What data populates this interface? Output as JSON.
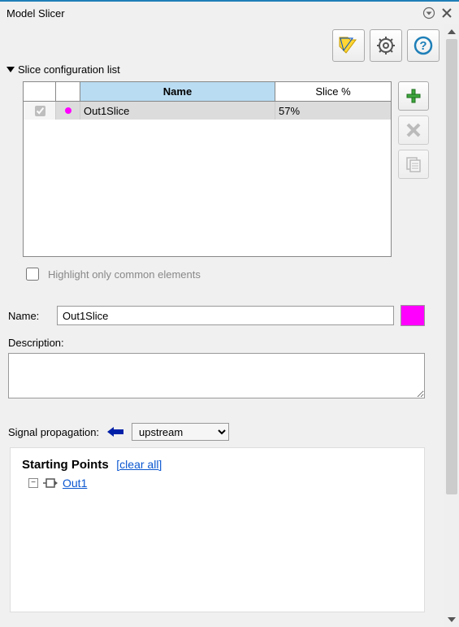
{
  "window": {
    "title": "Model Slicer"
  },
  "section_list": {
    "label": "Slice configuration list"
  },
  "table": {
    "columns": {
      "name": "Name",
      "pct": "Slice %"
    },
    "rows": [
      {
        "checked": true,
        "color": "#ff00ff",
        "name": "Out1Slice",
        "pct": "57%"
      }
    ]
  },
  "highlight": {
    "label": "Highlight only common elements",
    "checked": false
  },
  "name_field": {
    "label": "Name:",
    "value": "Out1Slice"
  },
  "color_swatch": "#ff00ff",
  "description": {
    "label": "Description:",
    "value": ""
  },
  "signal": {
    "label": "Signal propagation:",
    "direction_icon": "left-arrow",
    "value": "upstream",
    "options": [
      "upstream"
    ]
  },
  "starting_points": {
    "title": "Starting Points",
    "clear": "[clear all]",
    "items": [
      {
        "label": "Out1"
      }
    ]
  },
  "toolbar": {
    "highlight_btn": "highlight-model",
    "settings_btn": "settings",
    "help_btn": "help"
  },
  "side_actions": {
    "add": "add-slice",
    "delete": "delete-slice",
    "copy": "copy-slice"
  }
}
